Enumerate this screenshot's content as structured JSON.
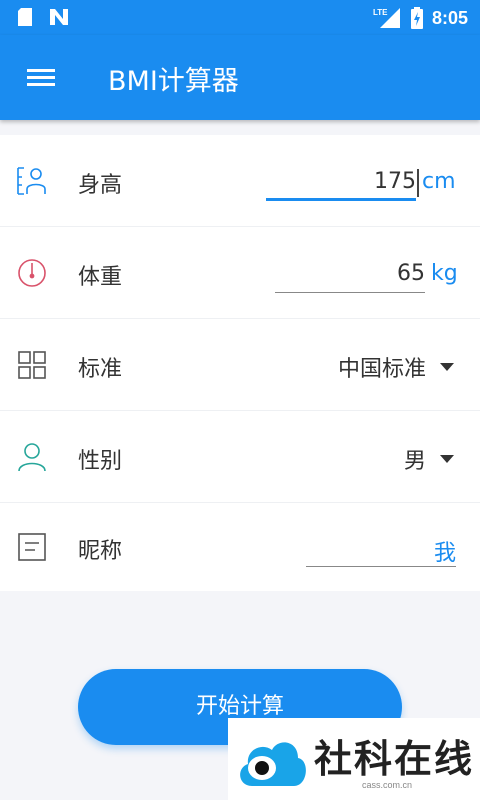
{
  "status_bar": {
    "time": "8:05",
    "network": "LTE",
    "icons": [
      "sd-card-icon",
      "n-notification-icon",
      "signal-icon",
      "battery-charging-icon"
    ]
  },
  "app_bar": {
    "title": "BMI计算器",
    "menu_icon": "hamburger-menu-icon"
  },
  "form": {
    "height": {
      "label": "身高",
      "value": "175",
      "unit": "cm",
      "icon": "person-height-icon"
    },
    "weight": {
      "label": "体重",
      "value": "65",
      "unit": "kg",
      "icon": "scale-gauge-icon"
    },
    "standard": {
      "label": "标准",
      "value": "中国标准",
      "icon": "grid-icon"
    },
    "gender": {
      "label": "性别",
      "value": "男",
      "icon": "person-icon"
    },
    "nickname": {
      "label": "昵称",
      "value": "我",
      "icon": "note-icon"
    }
  },
  "actions": {
    "calculate_label": "开始计算"
  },
  "watermark": {
    "text": "社科在线",
    "url": "cass.com.cn"
  },
  "colors": {
    "primary": "#1a8cf0",
    "weight_icon": "#d9536b",
    "gender_icon": "#26a69a",
    "text": "#333333"
  }
}
